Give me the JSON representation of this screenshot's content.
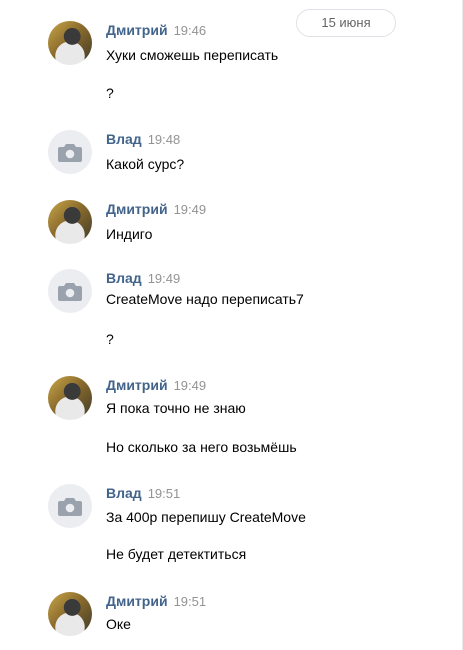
{
  "date_divider": "15 июня",
  "messages": [
    {
      "name": "Дмитрий",
      "time": "19:46",
      "avatar": "user-photo",
      "lines": [
        "Хуки сможешь переписать",
        "?"
      ]
    },
    {
      "name": "Влад",
      "time": "19:48",
      "avatar": "camera-icon",
      "lines": [
        "Какой сурс?"
      ]
    },
    {
      "name": "Дмитрий",
      "time": "19:49",
      "avatar": "user-photo",
      "lines": [
        "Индиго"
      ]
    },
    {
      "name": "Влад",
      "time": "19:49",
      "avatar": "camera-icon",
      "lines": [
        "CreateMove надо переписать7",
        "?"
      ]
    },
    {
      "name": "Дмитрий",
      "time": "19:49",
      "avatar": "user-photo",
      "lines": [
        "Я пока точно не знаю",
        "Но сколько за него возьмёшь"
      ]
    },
    {
      "name": "Влад",
      "time": "19:51",
      "avatar": "camera-icon",
      "lines": [
        "За 400р перепишу CreateMove",
        "Не будет детектиться"
      ]
    },
    {
      "name": "Дмитрий",
      "time": "19:51",
      "avatar": "user-photo",
      "lines": [
        "Оке"
      ]
    }
  ]
}
